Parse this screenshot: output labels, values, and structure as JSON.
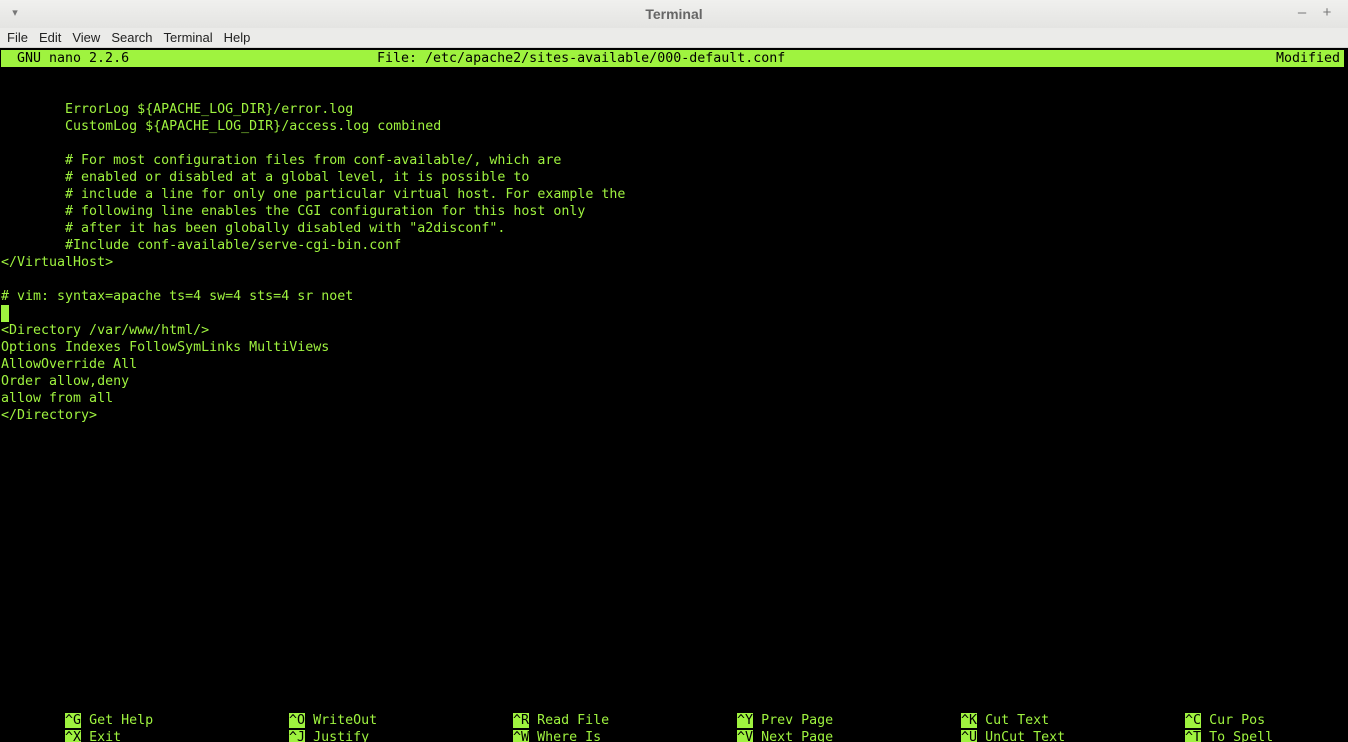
{
  "window": {
    "title": "Terminal",
    "collapse_icon": "▾",
    "minimize_icon": "–",
    "maximize_icon": "+"
  },
  "menu": {
    "items": [
      "File",
      "Edit",
      "View",
      "Search",
      "Terminal",
      "Help"
    ]
  },
  "nano": {
    "version": "GNU nano 2.2.6",
    "file": "File: /etc/apache2/sites-available/000-default.conf",
    "status": "Modified"
  },
  "editor": {
    "lines": [
      "",
      "        ErrorLog ${APACHE_LOG_DIR}/error.log",
      "        CustomLog ${APACHE_LOG_DIR}/access.log combined",
      "",
      "        # For most configuration files from conf-available/, which are",
      "        # enabled or disabled at a global level, it is possible to",
      "        # include a line for only one particular virtual host. For example the",
      "        # following line enables the CGI configuration for this host only",
      "        # after it has been globally disabled with \"a2disconf\".",
      "        #Include conf-available/serve-cgi-bin.conf",
      "</VirtualHost>",
      "",
      "# vim: syntax=apache ts=4 sw=4 sts=4 sr noet",
      "",
      "<Directory /var/www/html/>",
      "Options Indexes FollowSymLinks MultiViews",
      "AllowOverride All",
      "Order allow,deny",
      "allow from all",
      "</Directory>"
    ]
  },
  "shortcuts": [
    {
      "key": "^G",
      "label": "Get Help"
    },
    {
      "key": "^O",
      "label": "WriteOut"
    },
    {
      "key": "^R",
      "label": "Read File"
    },
    {
      "key": "^Y",
      "label": "Prev Page"
    },
    {
      "key": "^K",
      "label": "Cut Text"
    },
    {
      "key": "^C",
      "label": "Cur Pos"
    },
    {
      "key": "^X",
      "label": "Exit"
    },
    {
      "key": "^J",
      "label": "Justify"
    },
    {
      "key": "^W",
      "label": "Where Is"
    },
    {
      "key": "^V",
      "label": "Next Page"
    },
    {
      "key": "^U",
      "label": "UnCut Text"
    },
    {
      "key": "^T",
      "label": "To Spell"
    }
  ],
  "colors": {
    "foreground": "#9ff33f",
    "background": "#000000"
  }
}
